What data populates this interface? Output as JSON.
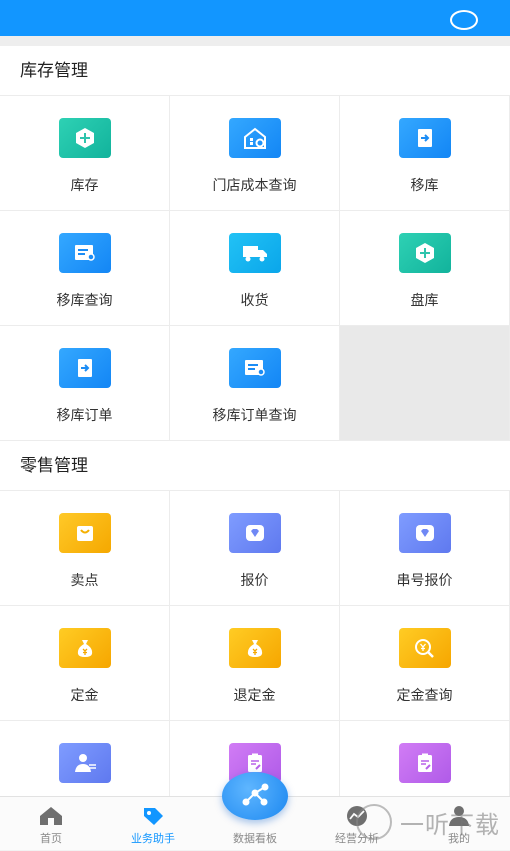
{
  "sections": [
    {
      "title": "库存管理",
      "items": [
        {
          "label": "库存",
          "icon": "inventory-icon",
          "color": "teal"
        },
        {
          "label": "门店成本查询",
          "icon": "store-cost-icon",
          "color": "blue"
        },
        {
          "label": "移库",
          "icon": "transfer-icon",
          "color": "blue"
        },
        {
          "label": "移库查询",
          "icon": "transfer-query-icon",
          "color": "blue"
        },
        {
          "label": "收货",
          "icon": "truck-icon",
          "color": "cyan"
        },
        {
          "label": "盘库",
          "icon": "stocktake-icon",
          "color": "teal"
        },
        {
          "label": "移库订单",
          "icon": "transfer-order-icon",
          "color": "blue"
        },
        {
          "label": "移库订单查询",
          "icon": "transfer-order-query-icon",
          "color": "blue"
        }
      ]
    },
    {
      "title": "零售管理",
      "items": [
        {
          "label": "卖点",
          "icon": "shopping-bag-icon",
          "color": "yellow"
        },
        {
          "label": "报价",
          "icon": "diamond-tag-icon",
          "color": "periw"
        },
        {
          "label": "串号报价",
          "icon": "diamond-tag-icon",
          "color": "periw"
        },
        {
          "label": "定金",
          "icon": "money-bag-icon",
          "color": "orange"
        },
        {
          "label": "退定金",
          "icon": "money-bag-icon",
          "color": "orange"
        },
        {
          "label": "定金查询",
          "icon": "yuan-search-icon",
          "color": "orange"
        },
        {
          "label": "",
          "icon": "person-yuan-icon",
          "color": "periw"
        },
        {
          "label": "",
          "icon": "clipboard-edit-icon",
          "color": "purple"
        },
        {
          "label": "",
          "icon": "clipboard-edit-icon",
          "color": "purple"
        }
      ]
    }
  ],
  "tabbar": {
    "tabs": [
      {
        "label": "首页",
        "icon": "home-icon",
        "active": false
      },
      {
        "label": "业务助手",
        "icon": "tag-icon",
        "active": true
      },
      {
        "label": "数据看板",
        "icon": "dashboard-fab-icon",
        "active": false
      },
      {
        "label": "经营分析",
        "icon": "analysis-icon",
        "active": false
      },
      {
        "label": "我的",
        "icon": "user-icon",
        "active": false
      }
    ]
  },
  "watermark": {
    "text": "一听下载"
  },
  "colors": {
    "primary": "#1296ff",
    "active_tab": "#1296ff"
  }
}
